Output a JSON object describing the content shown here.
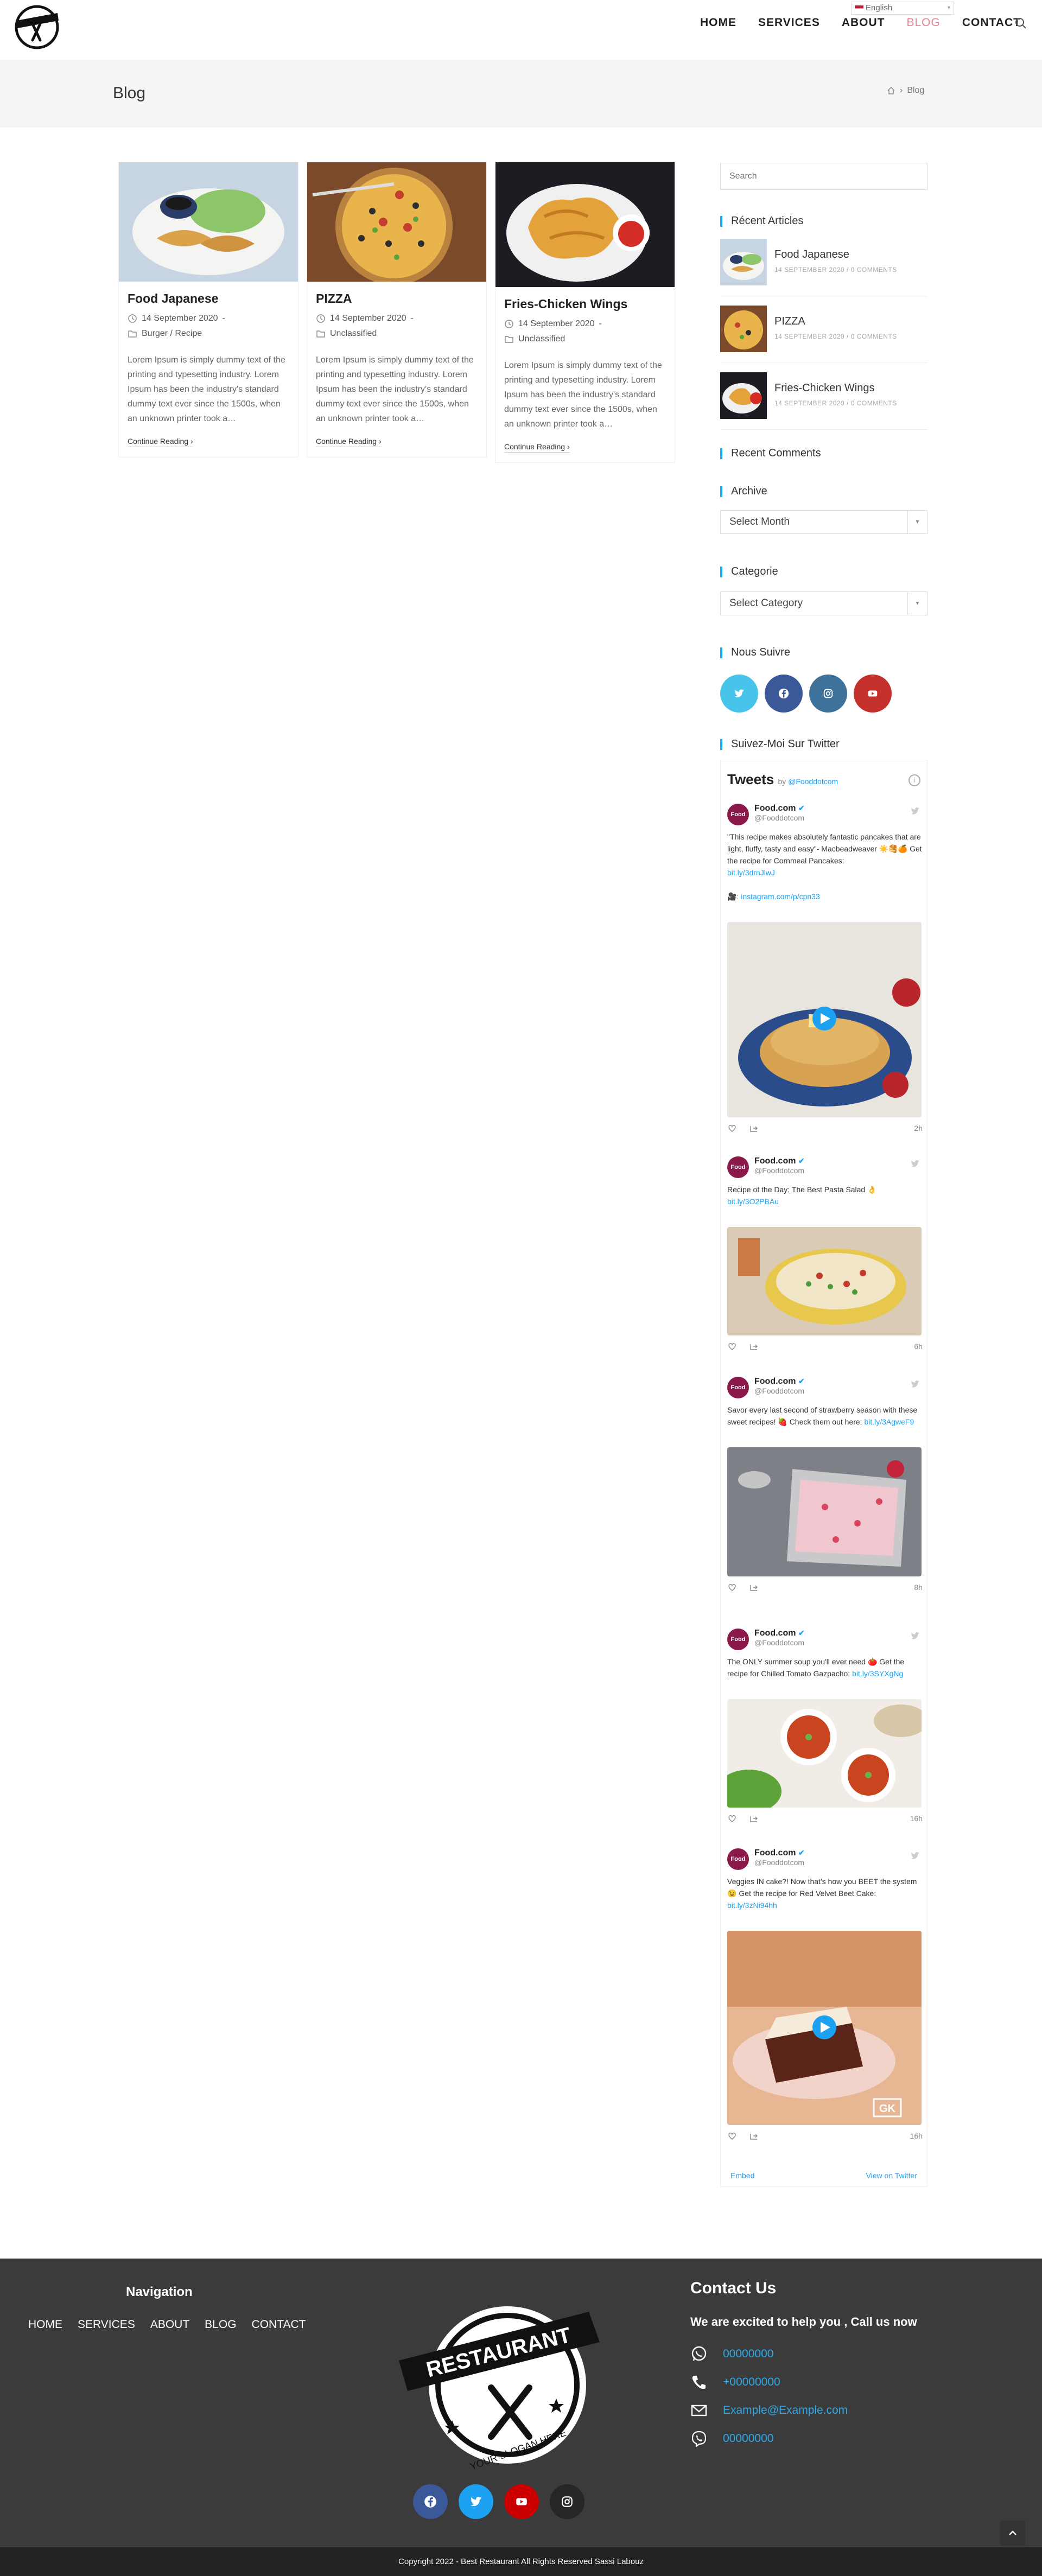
{
  "header": {
    "language": "English",
    "nav": [
      {
        "label": "HOME"
      },
      {
        "label": "SERVICES"
      },
      {
        "label": "ABOUT"
      },
      {
        "label": "BLOG"
      },
      {
        "label": "CONTACT"
      }
    ],
    "active_nav": "BLOG"
  },
  "page": {
    "title": "Blog",
    "breadcrumb_current": "Blog"
  },
  "posts": [
    {
      "title": "Food Japanese",
      "date": "14 September 2020",
      "categories": "Burger / Recipe",
      "excerpt": "Lorem Ipsum is simply dummy text of the printing and typesetting industry. Lorem Ipsum has been the industry's standard dummy text ever since the 1500s, when an unknown printer took a…",
      "more": "Continue Reading"
    },
    {
      "title": "PIZZA",
      "date": "14 September 2020",
      "categories": "Unclassified",
      "excerpt": "Lorem Ipsum is simply dummy text of the printing and typesetting industry. Lorem Ipsum has been the industry's standard dummy text ever since the 1500s, when an unknown printer took a…",
      "more": "Continue Reading"
    },
    {
      "title": "Fries-Chicken Wings",
      "date": "14 September 2020",
      "categories": "Unclassified",
      "excerpt": "Lorem Ipsum is simply dummy text of the printing and typesetting industry. Lorem Ipsum has been the industry's standard dummy text ever since the 1500s, when an unknown printer took a…",
      "more": "Continue Reading"
    }
  ],
  "sidebar": {
    "search_placeholder": "Search",
    "recent_heading": "Récent Articles",
    "recent": [
      {
        "title": "Food Japanese",
        "meta": "14 SEPTEMBER 2020 / 0 COMMENTS"
      },
      {
        "title": "PIZZA",
        "meta": "14 SEPTEMBER 2020 / 0 COMMENTS"
      },
      {
        "title": "Fries-Chicken Wings",
        "meta": "14 SEPTEMBER 2020 / 0 COMMENTS"
      }
    ],
    "comments_heading": "Recent Comments",
    "archive_heading": "Archive",
    "archive_value": "Select Month",
    "category_heading": "Categorie",
    "category_value": "Select Category",
    "follow_heading": "Nous Suivre",
    "twitter_heading": "Suivez-Moi Sur Twitter"
  },
  "twitter": {
    "title": "Tweets",
    "by": "by",
    "handle": "@Fooddotcom",
    "tweets": [
      {
        "name": "Food.com",
        "handle": "@Fooddotcom",
        "text": "\"This recipe makes absolutely fantastic pancakes that are light, fluffy, tasty and easy\"- Macbeadweaver ☀️🥞🍊 Get the recipe for Cornmeal Pancakes:",
        "link": "bit.ly/3drnJlwJ",
        "extra": "🎥: instagram.com/p/cpn33",
        "time": "2h"
      },
      {
        "name": "Food.com",
        "handle": "@Fooddotcom",
        "text": "Recipe of the Day: The Best Pasta Salad 👌",
        "link": "bit.ly/3O2PBAu",
        "time": "6h"
      },
      {
        "name": "Food.com",
        "handle": "@Fooddotcom",
        "text": "Savor every last second of strawberry season with these sweet recipes! 🍓 Check them out here:",
        "link": "bit.ly/3AgweF9",
        "time": "8h"
      },
      {
        "name": "Food.com",
        "handle": "@Fooddotcom",
        "text": "The ONLY summer soup you'll ever need 🍅 Get the recipe for Chilled Tomato Gazpacho:",
        "link": "bit.ly/3SYXgNg",
        "time": "16h"
      },
      {
        "name": "Food.com",
        "handle": "@Fooddotcom",
        "text": "Veggies IN cake?! Now that's how you BEET the system 😉 Get the recipe for Red Velvet Beet Cake:",
        "link": "bit.ly/3zNi94hh",
        "time": "16h"
      }
    ],
    "embed": "Embed",
    "view": "View on Twitter"
  },
  "footer": {
    "nav_heading": "Navigation",
    "nav": [
      "HOME",
      "SERVICES",
      "ABOUT",
      "BLOG",
      "CONTACT"
    ],
    "logo_text": "RESTAURANT",
    "logo_slogan": "YOUR SLOGAN HERE",
    "contact_heading": "Contact Us",
    "contact_sub": "We are excited to help you , Call us now",
    "whatsapp": "00000000",
    "phone": "+00000000",
    "email": "Example@Example.com",
    "viber": "00000000",
    "copyright": "Copyright 2022 - Best Restaurant All Rights Reserved Sassi Labouz"
  },
  "colors": {
    "accent": "#13aff0",
    "nav_active": "#e8858f",
    "footer_bg": "#3b3b3b",
    "link": "#31a8e6"
  }
}
